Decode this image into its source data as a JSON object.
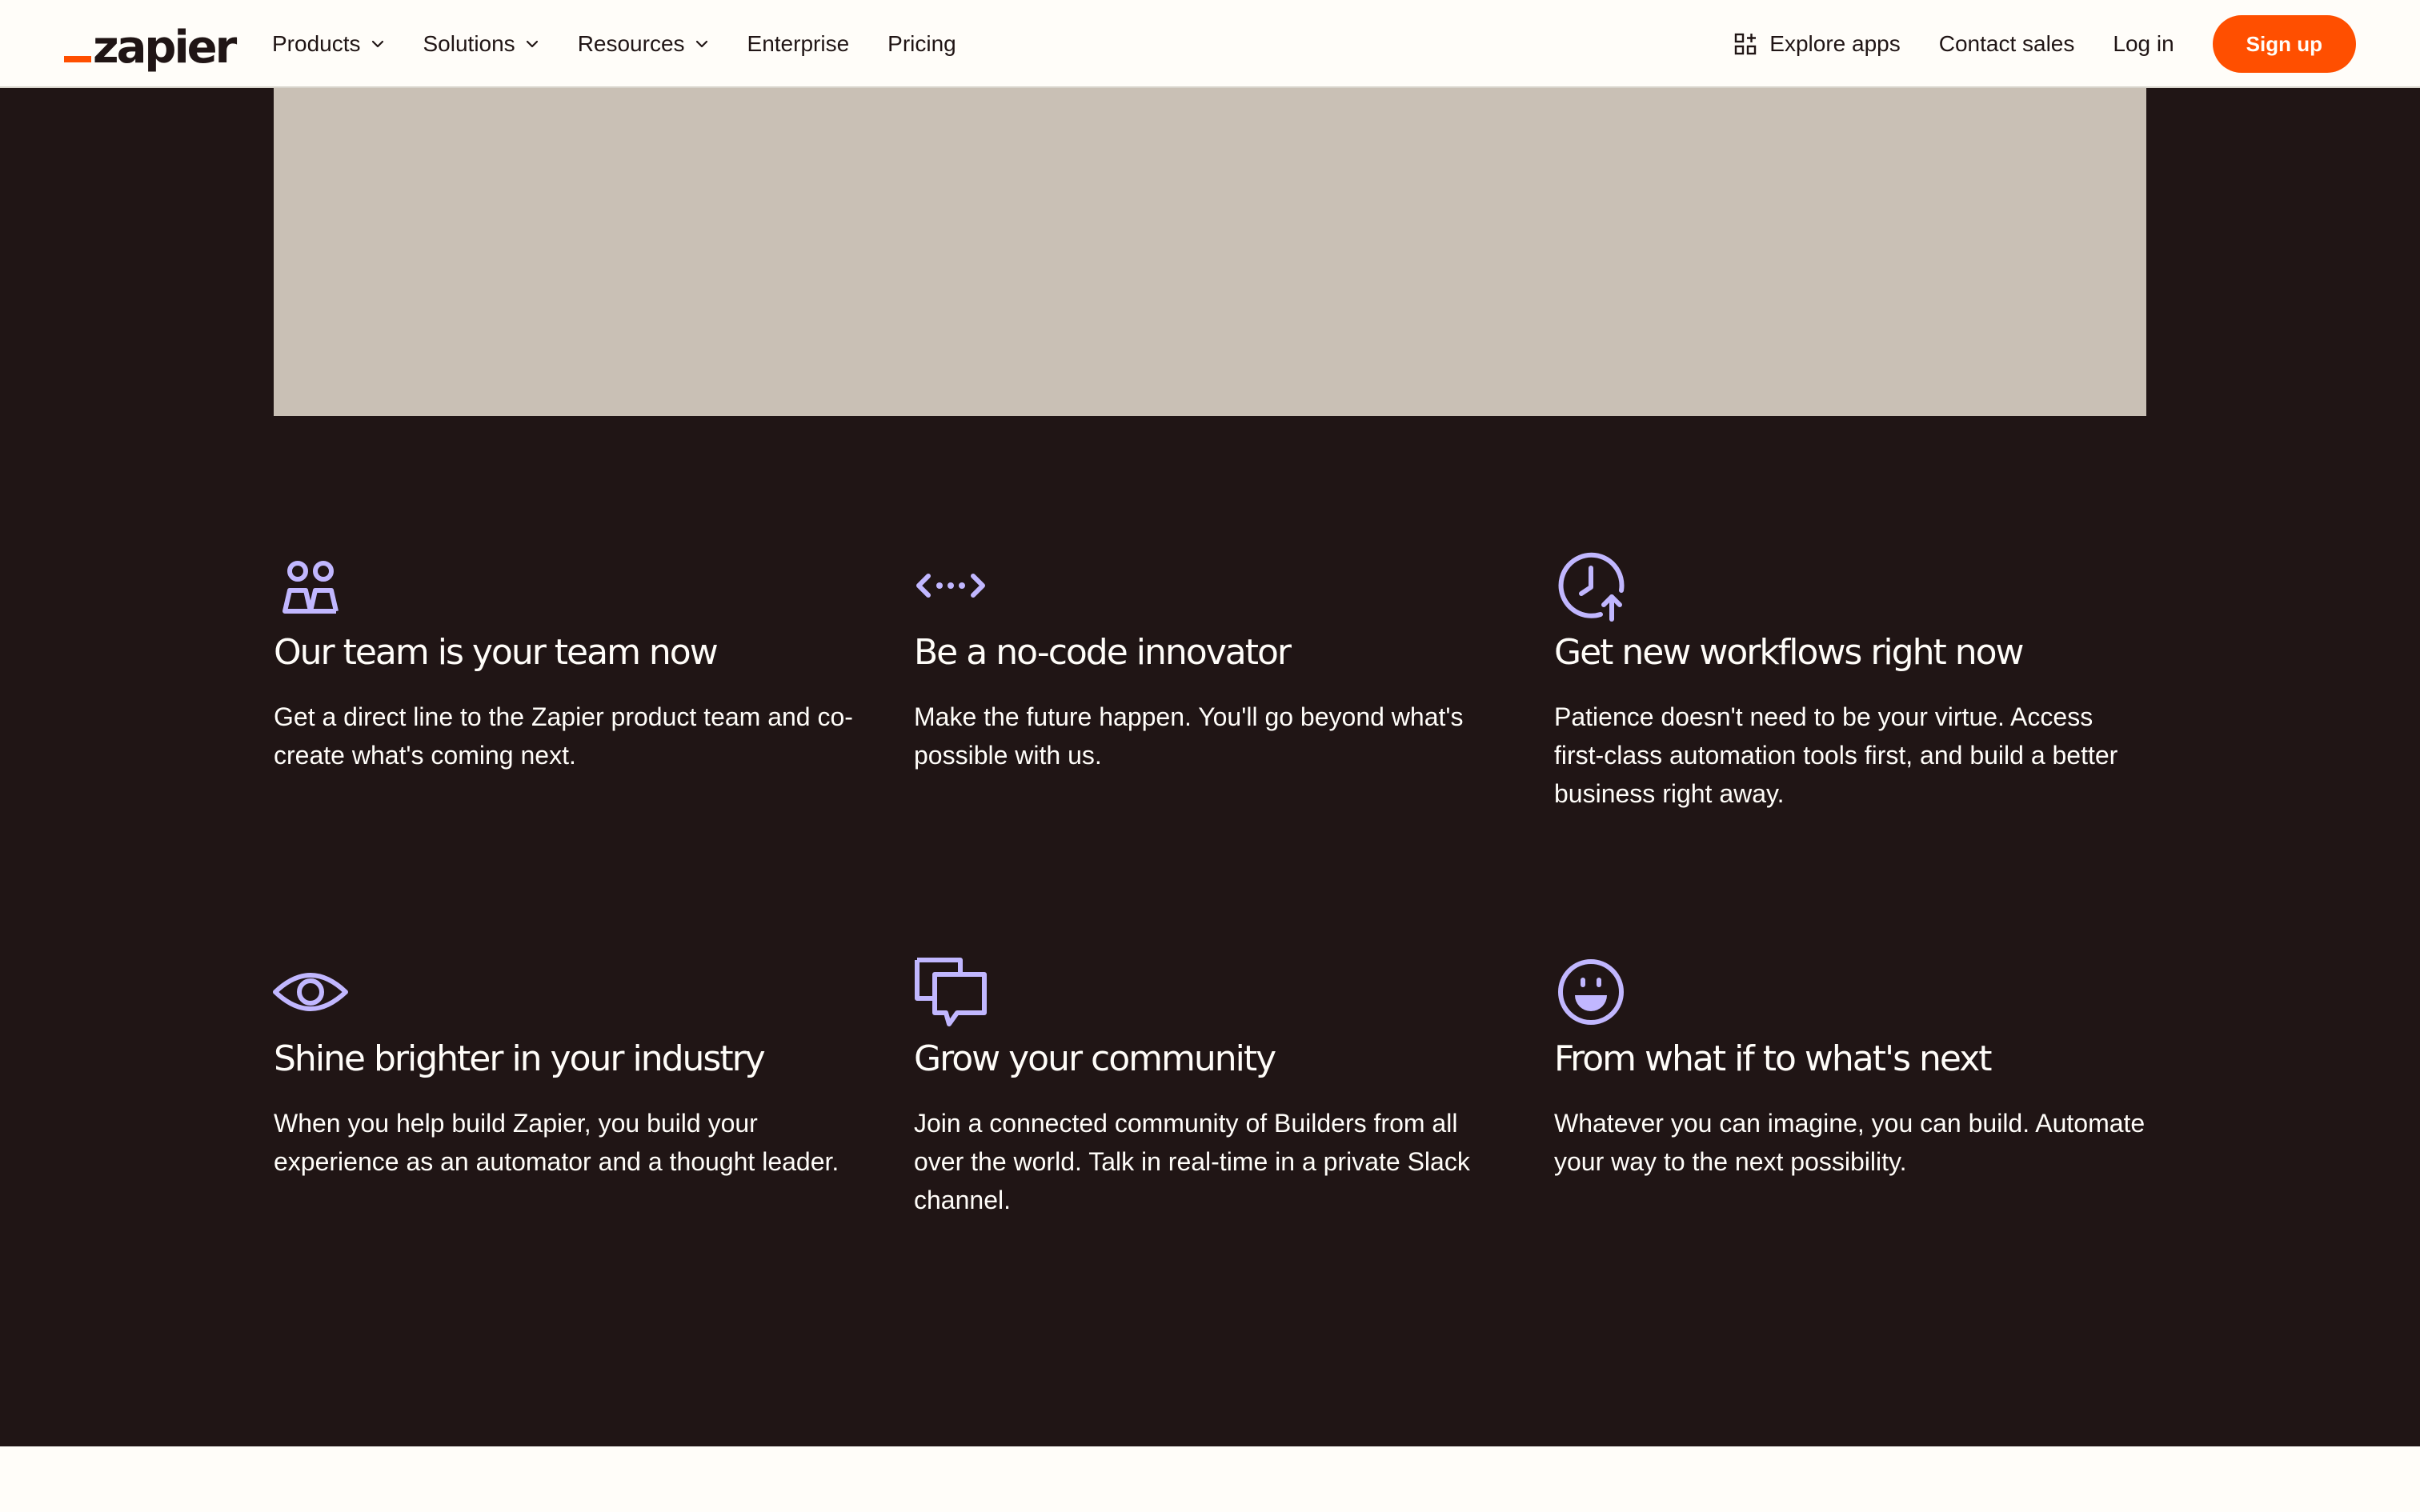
{
  "brand": {
    "name": "zapier",
    "accent_color": "#ff4f00",
    "dark_bg": "#201515",
    "icon_color": "#c1b7ff"
  },
  "nav": {
    "products": "Products",
    "solutions": "Solutions",
    "resources": "Resources",
    "enterprise": "Enterprise",
    "pricing": "Pricing",
    "explore_apps": "Explore apps",
    "contact_sales": "Contact sales",
    "log_in": "Log in",
    "sign_up": "Sign up"
  },
  "features": [
    {
      "icon": "team-icon",
      "title": "Our team is your team now",
      "text": "Get a direct line to the Zapier product team and co-create what's coming next."
    },
    {
      "icon": "code-icon",
      "title": "Be a no-code innovator",
      "text": "Make the future happen. You'll go beyond what's possible with us."
    },
    {
      "icon": "clock-arrow-icon",
      "title": "Get new workflows right now",
      "text": "Patience doesn't need to be your virtue. Access first-class automation tools first, and build a better business right away."
    },
    {
      "icon": "eye-icon",
      "title": "Shine brighter in your industry",
      "text": "When you help build Zapier, you build your experience as an automator and a thought leader."
    },
    {
      "icon": "chat-icon",
      "title": "Grow your community",
      "text": "Join a connected community of Builders from all over the world. Talk in real-time in a private Slack channel."
    },
    {
      "icon": "smiley-icon",
      "title": "From what if to what's next",
      "text": "Whatever you can imagine, you can build. Automate your way to the next possibility."
    }
  ]
}
